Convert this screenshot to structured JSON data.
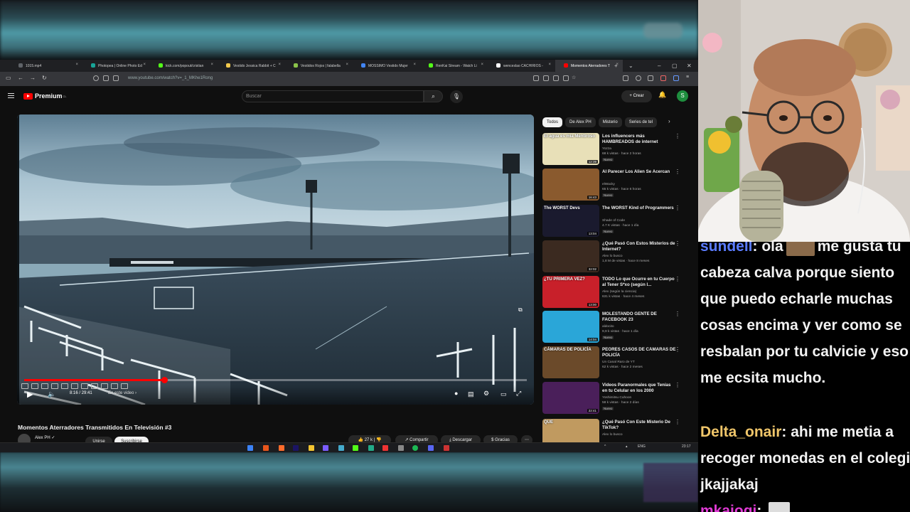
{
  "browser": {
    "tabs": [
      {
        "label": "1015.mp4",
        "favicon_color": "#5f6368"
      },
      {
        "label": "Photopea | Online Photo Ed",
        "favicon_color": "#18a497"
      },
      {
        "label": "kick.com/popout/cristian",
        "favicon_color": "#53fc18"
      },
      {
        "label": "Vestido Jessica Rabbit + C",
        "favicon_color": "#f2c94c"
      },
      {
        "label": "Vestidos Rojos | falabella",
        "favicon_color": "#8bc34a"
      },
      {
        "label": "MOSSIMO Vestido Mujer",
        "favicon_color": "#4285f4"
      },
      {
        "label": "RenKai Stream - Watch Li",
        "favicon_color": "#53fc18"
      },
      {
        "label": "wenceslao CACHIRIOS -",
        "favicon_color": "#ffffff"
      },
      {
        "label": "Momentos Aterradores T",
        "favicon_color": "#ff0000",
        "active": true
      }
    ],
    "url": "www.youtube.com/watch?v=_1_MKhe1Rong"
  },
  "youtube": {
    "logo": "Premium",
    "logo_region": "CL",
    "search_placeholder": "Buscar",
    "create_label": "Crear",
    "avatar_letter": "S",
    "player": {
      "time": "8:16 / 29:41",
      "chapter": "En este video",
      "progress": 0.278
    },
    "video_title": "Momentos Aterradores Transmitidos En Televisión #3",
    "channel": "Alex PH",
    "join_label": "Unirse",
    "subscribe_label": "Suscribirse",
    "likes": "27 k",
    "share_label": "Compartir",
    "download_label": "Descargar",
    "thanks_label": "Gracias",
    "chips": [
      "Todos",
      "De Alex PH",
      "Misterio",
      "Series de tel"
    ],
    "recommendations": [
      {
        "title": "Los influencers más HAMBREADOS de internet",
        "channel": "Yozza",
        "meta": "68 k vistas · hace 2 horas",
        "badge": "Nuevo",
        "duration": "12:39",
        "thumb_text": "El agua es mía  Mentiroso",
        "thumb_color": "#e8e0b8"
      },
      {
        "title": "Al Parecer Los Alien Se Acercan",
        "channel": "elWacky",
        "meta": "65 k vistas · hace 6 horas",
        "badge": "Nuevo",
        "duration": "16:43",
        "thumb_text": "",
        "thumb_color": "#8a5a2e"
      },
      {
        "title": "The WORST Kind of Programmers",
        "channel": "Shade of Code",
        "meta": "4.7 K vistas · hace 1 día",
        "badge": "Nuevo",
        "duration": "13:04",
        "thumb_text": "The WORST Devs",
        "thumb_color": "#1a1a2e"
      },
      {
        "title": "¿Qué Pasó Con Estos Misterios de Internet?",
        "channel": "Alex lo busco",
        "meta": "1,8 M de vistas · hace 8 meses",
        "badge": "",
        "duration": "32:02",
        "thumb_text": "",
        "thumb_color": "#3b2a20"
      },
      {
        "title": "TODO Lo que Ocurre en tu Cuerpo al Tener S*xo (según l...",
        "channel": "Alex (según la ciencia)",
        "meta": "631 k vistas · hace 4 meses",
        "badge": "",
        "duration": "13:00",
        "thumb_text": "¿TU PRIMERA VEZ?",
        "thumb_color": "#c8202a"
      },
      {
        "title": "MOLESTANDO GENTE DE FACEBOOK 23",
        "channel": "aldocito",
        "meta": "9,9 k vistas · hace 1 día",
        "badge": "Nuevo",
        "duration": "14:04",
        "thumb_text": "",
        "thumb_color": "#2aa6d8"
      },
      {
        "title": "PEORES CASOS DE CÁMARAS DE POLICÍA",
        "channel": "Un Canal Raro de YT",
        "meta": "62 k vistas · hace 2 meses",
        "badge": "",
        "duration": "",
        "thumb_text": "CÁMARAS DE POLICÍA",
        "thumb_color": "#6b4a2a"
      },
      {
        "title": "Videos Paranormales que Tenías en tu Celular en los 2000",
        "channel": "Yoshimitsu Cuhoon",
        "meta": "58 k vistas · hace 2 días",
        "badge": "Nuevo",
        "duration": "22:41",
        "thumb_text": "",
        "thumb_color": "#4a1f5a"
      },
      {
        "title": "¿Qué Pasó Con Este Misterio De TikTok?",
        "channel": "Alex lo busco",
        "meta": "",
        "badge": "",
        "duration": "",
        "thumb_text": "QUE",
        "thumb_color": "#c09a60"
      }
    ]
  },
  "taskbar": {
    "lang": "ENG",
    "time": "23:17"
  },
  "chat": {
    "messages": [
      {
        "user": "sundell",
        "user_color": "#5b7cff",
        "text_before": "ola",
        "text_after": "me gusta tu cabeza calva porque siento que puedo echarle muchas cosas encima y ver como se resbalan por tu calvicie y eso me ecsita mucho."
      },
      {
        "user": "Delta_onair",
        "user_color": "#f0c66a",
        "text": "ahi me metia a recoger monedas en el colegio jkajjakaj"
      },
      {
        "user": "mkaiogi",
        "user_color": "#e23bd6",
        "text": ""
      }
    ]
  },
  "colors": {
    "youtube_red": "#ff0000",
    "yt_bg": "#0f0f0f",
    "chip_active": "#f1f1f1"
  }
}
